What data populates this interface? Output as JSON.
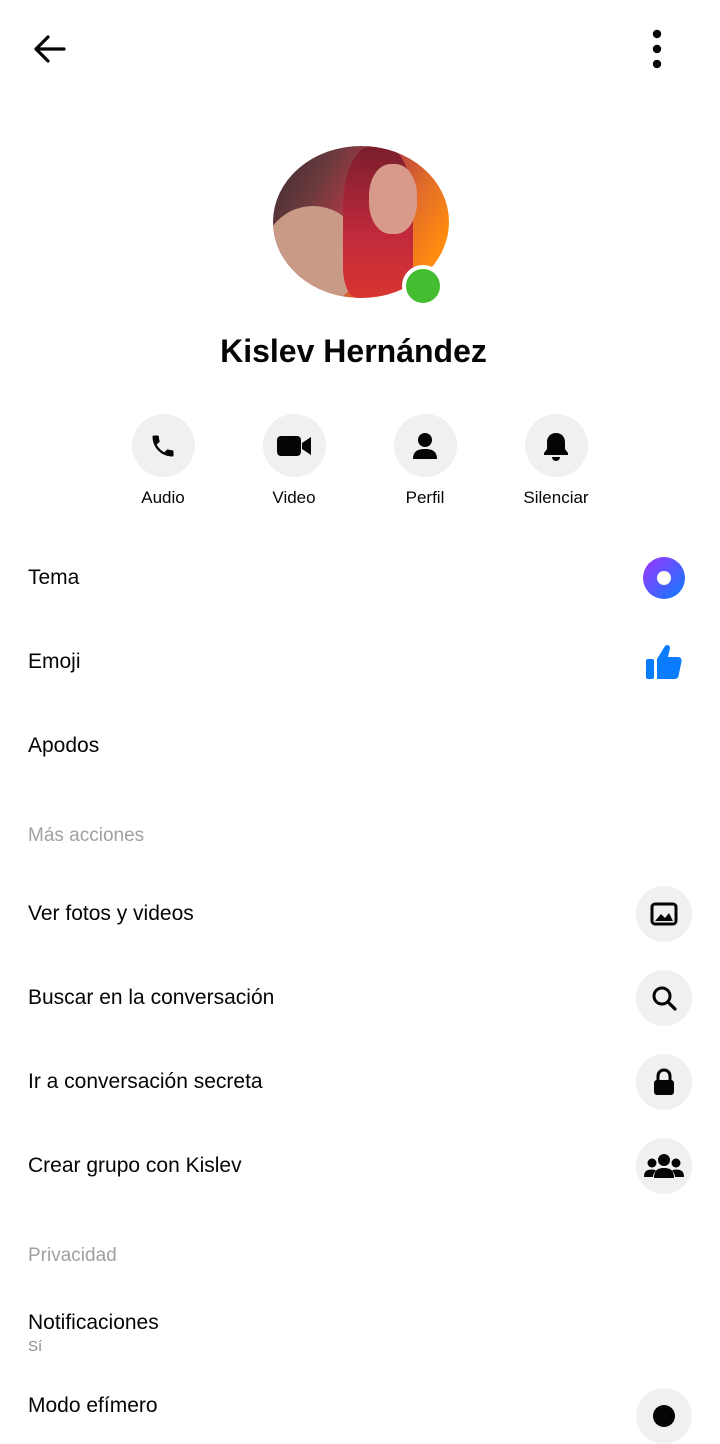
{
  "header": {
    "back_icon": "arrow-left-icon",
    "menu_icon": "more-vertical-icon"
  },
  "profile": {
    "name": "Kislev Hernández",
    "status": "online",
    "status_color": "#45bd30"
  },
  "actions": [
    {
      "label": "Audio",
      "icon": "phone-icon"
    },
    {
      "label": "Video",
      "icon": "video-camera-icon"
    },
    {
      "label": "Perfil",
      "icon": "person-icon"
    },
    {
      "label": "Silenciar",
      "icon": "bell-icon"
    }
  ],
  "settings": {
    "theme": {
      "label": "Tema",
      "icon": "theme-gradient-icon",
      "colors": [
        "#a033ff",
        "#0a7cff"
      ]
    },
    "emoji": {
      "label": "Emoji",
      "icon": "thumbs-up-icon",
      "color": "#0a7cff"
    },
    "nicknames": {
      "label": "Apodos"
    }
  },
  "more_actions": {
    "title": "Más acciones",
    "items": [
      {
        "label": "Ver fotos y videos",
        "icon": "image-icon"
      },
      {
        "label": "Buscar en la conversación",
        "icon": "search-icon"
      },
      {
        "label": "Ir a conversación secreta",
        "icon": "lock-icon"
      },
      {
        "label": "Crear grupo con Kislev",
        "icon": "group-icon"
      }
    ]
  },
  "privacy": {
    "title": "Privacidad",
    "notifications": {
      "label": "Notificaciones",
      "value": "Sí"
    },
    "vanish_mode": {
      "label": "Modo efímero",
      "icon": "vanish-mode-icon"
    }
  }
}
